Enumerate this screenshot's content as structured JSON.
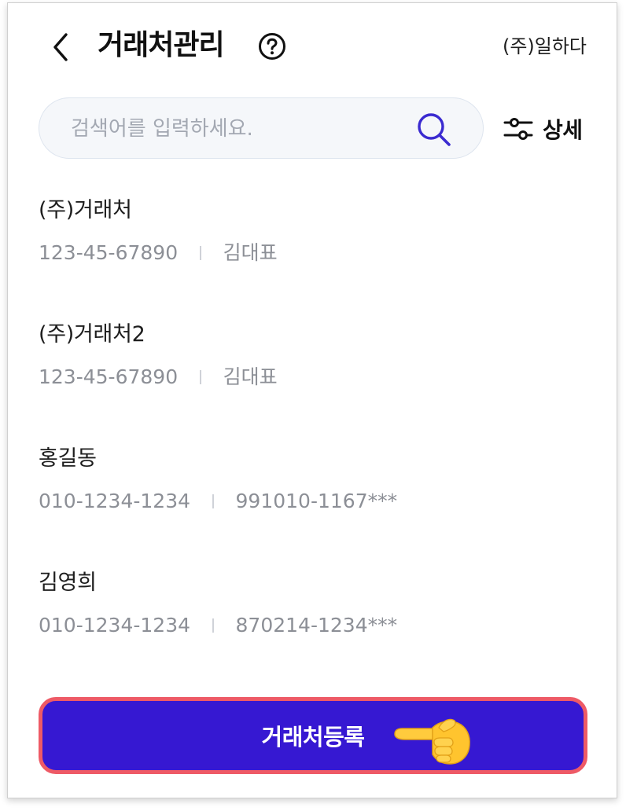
{
  "header": {
    "back_icon": "chevron-left-icon",
    "title": "거래처관리",
    "help_icon": "question-circle-icon",
    "company": "(주)일하다"
  },
  "search": {
    "placeholder": "검색어를 입력하세요.",
    "value": "",
    "icon": "search-icon"
  },
  "filter": {
    "icon": "sliders-icon",
    "label": "상세"
  },
  "clients": [
    {
      "name": "(주)거래처",
      "info1": "123-45-67890",
      "info2": "김대표"
    },
    {
      "name": "(주)거래처2",
      "info1": "123-45-67890",
      "info2": "김대표"
    },
    {
      "name": "홍길동",
      "info1": "010-1234-1234",
      "info2": "991010-1167***"
    },
    {
      "name": "김영희",
      "info1": "010-1234-1234",
      "info2": "870214-1234***"
    }
  ],
  "register_button": {
    "label": "거래처등록",
    "icon": "pointing-hand-icon"
  },
  "colors": {
    "accent": "#3618d2",
    "highlight_border": "#ee5a66",
    "search_icon": "#3a2ad0",
    "muted_text": "#8c8f96"
  }
}
